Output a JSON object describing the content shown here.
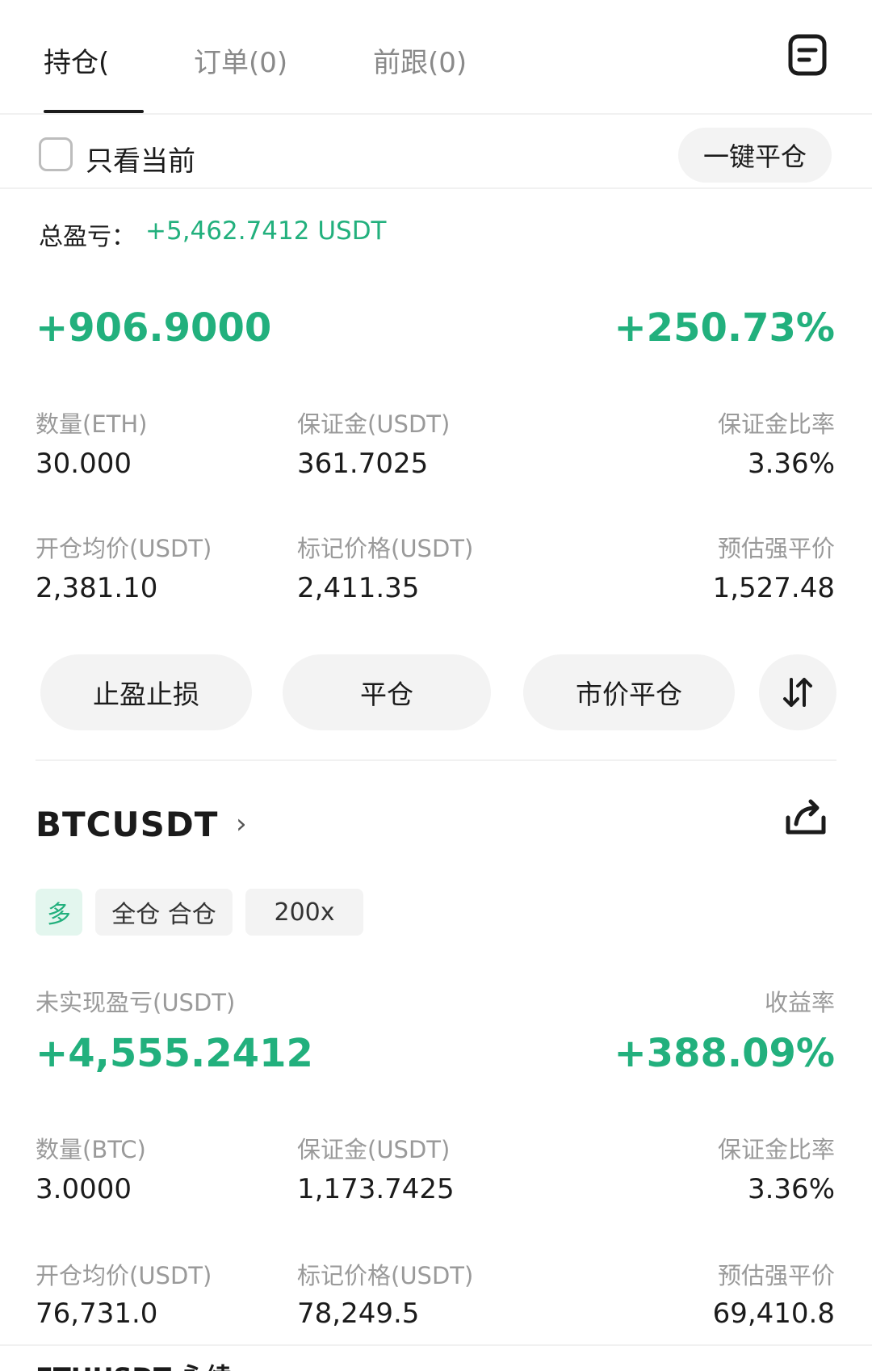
{
  "tabs": [
    {
      "label": "持仓(",
      "active": true
    },
    {
      "label": "订单(0)",
      "active": false
    },
    {
      "label": "前跟(0)",
      "active": false
    }
  ],
  "filter": {
    "label": "只看当前",
    "checked": false
  },
  "close_all_button": "一键平仓",
  "total_pnl": {
    "label": "总盈亏：",
    "value": "+5,462.7412 USDT"
  },
  "positions": [
    {
      "pnl": "+906.9000",
      "roi": "+250.73%",
      "fields": [
        {
          "label": "数量(ETH)",
          "value": "30.000"
        },
        {
          "label": "保证金(USDT)",
          "value": "361.7025"
        },
        {
          "label": "保证金比率",
          "value": "3.36%"
        },
        {
          "label": "开仓均价(USDT)",
          "value": "2,381.10"
        },
        {
          "label": "标记价格(USDT)",
          "value": "2,411.35"
        },
        {
          "label": "预估强平价",
          "value": "1,527.48"
        }
      ],
      "actions": [
        "止盈止损",
        "平仓",
        "市价平仓"
      ]
    },
    {
      "symbol": "BTCUSDT",
      "tags": {
        "side": "多",
        "mode": "全仓 合仓",
        "leverage": "200x"
      },
      "pnl_label": "未实现盈亏(USDT)",
      "roi_label": "收益率",
      "pnl": "+4,555.2412",
      "roi": "+388.09%",
      "fields": [
        {
          "label": "数量(BTC)",
          "value": "3.0000"
        },
        {
          "label": "保证金(USDT)",
          "value": "1,173.7425"
        },
        {
          "label": "保证金比率",
          "value": "3.36%"
        },
        {
          "label": "开仓均价(USDT)",
          "value": "76,731.0"
        },
        {
          "label": "标记价格(USDT)",
          "value": "78,249.5"
        },
        {
          "label": "预估强平价",
          "value": "69,410.8"
        }
      ]
    }
  ],
  "next_symbol_peek": "ETHUSDT 永续",
  "colors": {
    "green": "#22b07d",
    "pill_bg": "#f3f3f3"
  }
}
